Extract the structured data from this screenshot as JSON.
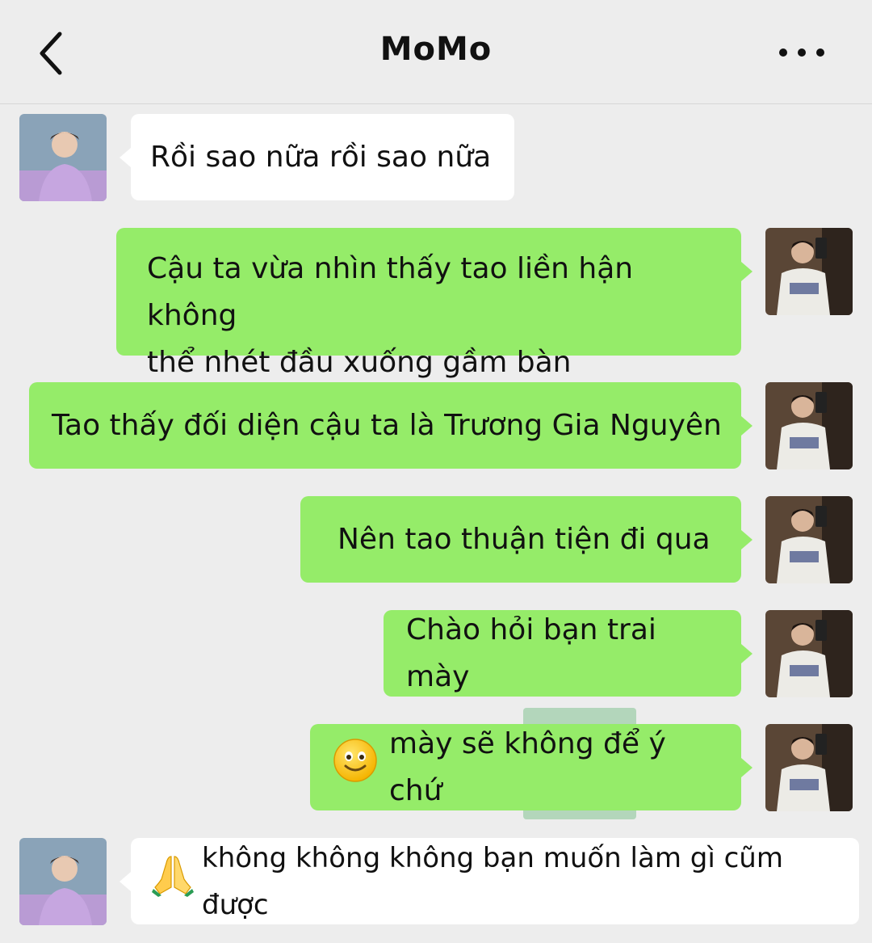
{
  "header": {
    "title": "MoMo",
    "back_icon": "chevron-left-icon",
    "more_icon": "more-dots-icon"
  },
  "colors": {
    "background": "#ededed",
    "incoming_bubble": "#ffffff",
    "outgoing_bubble": "#95ec69"
  },
  "messages": [
    {
      "side": "in",
      "text": "Rồi sao nữa rồi sao nữa"
    },
    {
      "side": "out",
      "line1": "Cậu ta vừa nhìn thấy tao liền hận không",
      "line2": "thể nhét đầu xuống gầm bàn"
    },
    {
      "side": "out",
      "text": "Tao thấy đối diện cậu ta là Trương Gia Nguyên"
    },
    {
      "side": "out",
      "text": "Nên tao thuận tiện đi qua"
    },
    {
      "side": "out",
      "text": "Chào hỏi bạn trai mày"
    },
    {
      "side": "out",
      "emoji": "slightly-smiling-face",
      "text": "mày sẽ không để ý chứ"
    },
    {
      "side": "in",
      "emoji": "folded-hands",
      "text": "không không không bạn muốn làm gì cũm được"
    }
  ]
}
